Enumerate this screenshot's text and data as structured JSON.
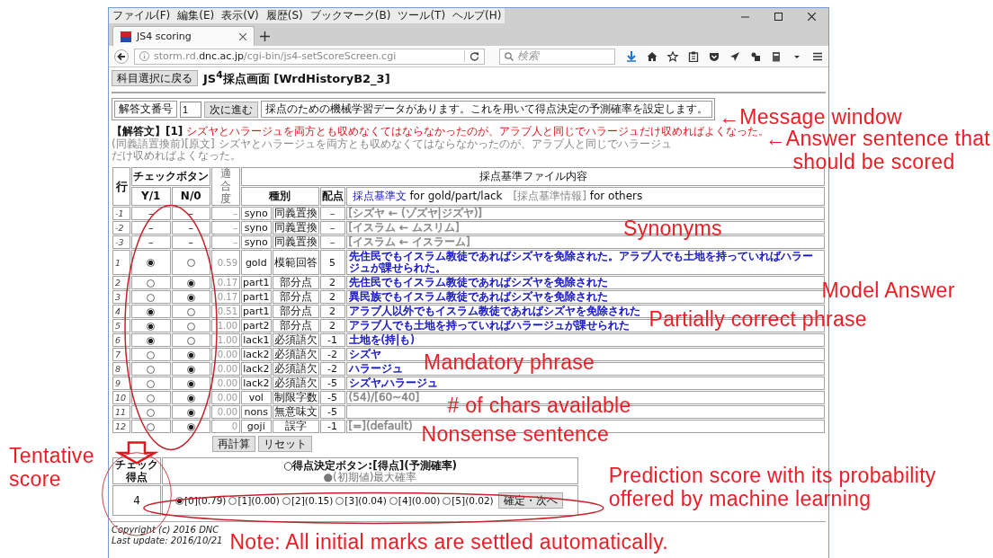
{
  "window": {
    "menu": [
      "ファイル(F)",
      "編集(E)",
      "表示(V)",
      "履歴(S)",
      "ブックマーク(B)",
      "ツール(T)",
      "ヘルプ(H)"
    ],
    "tabs": [
      {
        "title": "JS4 scoring",
        "selected": true
      }
    ],
    "address_bar": {
      "url_start": "storm.rd.",
      "url_domain": "dnc.ac.jp",
      "url_path": "/cgi-bin/js4-setScoreScreen.cgi"
    },
    "search_box": {
      "placeholder": "検索"
    }
  },
  "page": {
    "back_button": "科目選択に戻る",
    "title": "JS$^{4}$採点画面 [WrdHistoryB2_3]",
    "message_row": {
      "label": "解答文番号",
      "answer_number": "1",
      "next_button": "次に進む",
      "message": "採点のための機械学習データがあります。これを用いて得点決定の予測確率を設定します。"
    },
    "answer": {
      "label": "【解答文】[1]",
      "sentence": "シズヤとハラージュを両方とも収めなくてはならなかったのが、アラブ人と同じでハラージュだけ収めればよくなった。",
      "original": "(同義語置換前)[原文] シズヤとハラージュを両方とも収めなくてはならなかったのが、アラブ人と同じでハラージュだけ収めればよくなった。"
    },
    "table": {
      "headers": {
        "row": "行",
        "check_buttons": "チェックボタン",
        "yes": "Y/1",
        "no": "N/0",
        "fitness": "適合度",
        "content": "採点基準ファイル内容",
        "type": "種別",
        "points": "配点",
        "legend_criterion": "採点基準文",
        "legend_criterion_for": "for gold/part/lack",
        "legend_info": "[採点基準情報]",
        "legend_info_for": "for others"
      },
      "rows": [
        {
          "kind": "synonym",
          "row": "-1",
          "yes": "–",
          "no": "–",
          "fitness": "–",
          "type": "syno",
          "tag": "同義置換",
          "points": "–",
          "content": "[シズヤ ← (ゾズヤ|ジズヤ)]",
          "color": "#888888"
        },
        {
          "kind": "synonym",
          "row": "-2",
          "yes": "–",
          "no": "–",
          "fitness": "–",
          "type": "syno",
          "tag": "同義置換",
          "points": "–",
          "content": "[イスラム ← ムスリム]",
          "color": "#888888"
        },
        {
          "kind": "synonym",
          "row": "-3",
          "yes": "–",
          "no": "–",
          "fitness": "–",
          "type": "syno",
          "tag": "同義置換",
          "points": "–",
          "content": "[イスラム ← イスラーム]",
          "color": "#888888"
        },
        {
          "kind": "scored",
          "row": "1",
          "yes_selected": true,
          "no_selected": false,
          "fitness": "0.59",
          "type": "gold",
          "tag": "模範回答",
          "points": "5",
          "content": "先住民でもイスラム教徒であればシズヤを免除された。アラブ人でも土地を持っていればハラージュが課せられた。",
          "color": "#1414c8"
        },
        {
          "kind": "scored",
          "row": "2",
          "yes_selected": false,
          "no_selected": true,
          "fitness": "0.17",
          "type": "part1",
          "tag": "部分点",
          "points": "2",
          "content": "先住民でもイスラム教徒であればシズヤを免除された",
          "color": "#1414c8"
        },
        {
          "kind": "scored",
          "row": "3",
          "yes_selected": false,
          "no_selected": true,
          "fitness": "0.17",
          "type": "part1",
          "tag": "部分点",
          "points": "2",
          "content": "異民族でもイスラム教徒であればシズヤを免除された",
          "color": "#1414c8"
        },
        {
          "kind": "scored",
          "row": "4",
          "yes_selected": true,
          "no_selected": false,
          "fitness": "0.51",
          "type": "part1",
          "tag": "部分点",
          "points": "2",
          "content": "アラブ人以外でもイスラム教徒であればシズヤを免除された",
          "color": "#1414c8"
        },
        {
          "kind": "scored",
          "row": "5",
          "yes_selected": true,
          "no_selected": false,
          "fitness": "1.00",
          "type": "part2",
          "tag": "部分点",
          "points": "2",
          "content": "アラブ人でも土地を持っていればハラージュが課せられた",
          "color": "#1414c8"
        },
        {
          "kind": "scored",
          "row": "6",
          "yes_selected": true,
          "no_selected": false,
          "fitness": "1.00",
          "type": "lack1",
          "tag": "必須語欠",
          "points": "-1",
          "content": "土地を(持|も)",
          "color": "#1414c8"
        },
        {
          "kind": "scored",
          "row": "7",
          "yes_selected": false,
          "no_selected": true,
          "fitness": "0.00",
          "type": "lack2",
          "tag": "必須語欠",
          "points": "-2",
          "content": "シズヤ",
          "color": "#1414c8"
        },
        {
          "kind": "scored",
          "row": "8",
          "yes_selected": false,
          "no_selected": true,
          "fitness": "0.00",
          "type": "lack2",
          "tag": "必須語欠",
          "points": "-2",
          "content": "ハラージュ",
          "color": "#1414c8"
        },
        {
          "kind": "scored",
          "row": "9",
          "yes_selected": false,
          "no_selected": true,
          "fitness": "0.00",
          "type": "lack2",
          "tag": "必須語欠",
          "points": "-5",
          "content": "シズヤ,ハラージュ",
          "color": "#1414c8"
        },
        {
          "kind": "scored",
          "row": "10",
          "yes_selected": false,
          "no_selected": true,
          "fitness": "0.00",
          "type": "vol",
          "tag": "制限字数",
          "points": "-5",
          "content": "(54)/[60~40]",
          "color": "#888888"
        },
        {
          "kind": "scored",
          "row": "11",
          "yes_selected": false,
          "no_selected": true,
          "fitness": "0.00",
          "type": "nons",
          "tag": "無意味文",
          "points": "-5"
        },
        {
          "kind": "scored",
          "row": "12",
          "yes_selected": false,
          "no_selected": true,
          "fitness": "0",
          "type": "goji",
          "tag": "誤字",
          "points": "-1",
          "content": "[=](default)",
          "color": "#888888"
        }
      ]
    },
    "buttons": [
      "再計算",
      "リセット"
    ],
    "score": {
      "check_label": "チェック得点",
      "check_value": "4",
      "title": "○得点決定ボタン:[得点](予測確率)",
      "subtitle": "●(初期値)最大確率",
      "options": [
        {
          "label": "[0](0.79)",
          "selected": true
        },
        {
          "label": "[1](0.00)",
          "selected": false
        },
        {
          "label": "[2](0.15)",
          "selected": false
        },
        {
          "label": "[3](0.04)",
          "selected": false
        },
        {
          "label": "[4](0.00)",
          "selected": false
        },
        {
          "label": "[5](0.02)",
          "selected": false
        }
      ],
      "confirm_button": "確定・次へ"
    },
    "footer": [
      "Copyright (c) 2016 DNC",
      "Last update: 2016/10/21"
    ]
  },
  "annotations": [
    {
      "lines": [
        "←Message window"
      ]
    },
    {
      "lines": [
        "←Answer sentence that",
        "should be scored"
      ]
    },
    {
      "lines": [
        "Synonyms"
      ]
    },
    {
      "lines": [
        "Model Answer"
      ]
    },
    {
      "lines": [
        "Partially correct phrase"
      ]
    },
    {
      "lines": [
        "Mandatory phrase"
      ]
    },
    {
      "lines": [
        "# of chars available"
      ]
    },
    {
      "lines": [
        "Nonsense sentence"
      ]
    },
    {
      "lines": [
        "Tentative",
        "score"
      ]
    },
    {
      "lines": [
        "Prediction score with its probability",
        "offered by machine learning"
      ]
    },
    {
      "lines": [
        "Note: All initial marks are settled automatically."
      ]
    }
  ]
}
